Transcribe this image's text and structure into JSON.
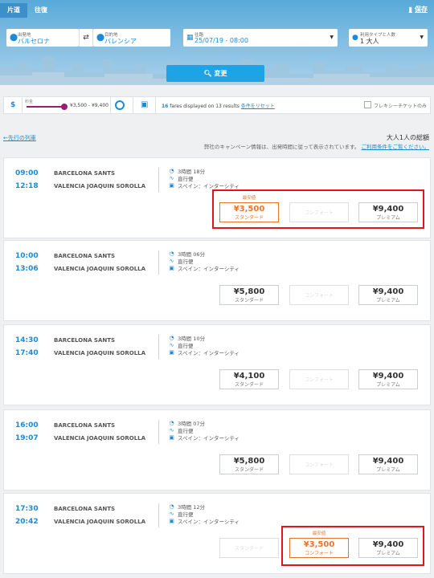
{
  "header": {
    "tabs": [
      {
        "label": "片道"
      },
      {
        "label": "往復"
      }
    ],
    "save_label": "保存"
  },
  "search": {
    "origin": {
      "label": "出発地",
      "value": "バルセロナ"
    },
    "destination": {
      "label": "目的地",
      "value": "バレンシア"
    },
    "date": {
      "label": "往路",
      "value": "25/07/19 - 08:00"
    },
    "passengers": {
      "label": "利用タイプと人数",
      "value": "1 大人"
    },
    "change_button": "変更"
  },
  "filters": {
    "currency_symbol": "$",
    "price_label": "料金",
    "price_range": "¥3,500 - ¥9,400",
    "results_count": "16",
    "results_text": "fares displayed on 13 results",
    "reset_link": "条件をリセット",
    "flexi_label": "フレキシーチケットのみ"
  },
  "list": {
    "prev_link": "先行の列車",
    "total_label": "大人1人の総額",
    "note_text": "弊社のキャンペーン情報は、出発時間に従って表示されています。",
    "note_link": "ご利用条件をご覧ください。",
    "cheapest_label": "最安値",
    "journeys": [
      {
        "dep_time": "09:00",
        "arr_time": "12:18",
        "dep_station": "BARCELONA SANTS",
        "arr_station": "VALENCIA JOAQUIN SOROLLA",
        "duration": "3時間 18分",
        "type": "直行便",
        "operator": "スペイン：インターシティ",
        "fares": [
          {
            "price": "¥3,500",
            "class": "スタンダード",
            "state": "cheapest"
          },
          {
            "price": "",
            "class": "コンフォート",
            "state": "disabled"
          },
          {
            "price": "¥9,400",
            "class": "プレミアム",
            "state": "normal"
          }
        ]
      },
      {
        "dep_time": "10:00",
        "arr_time": "13:06",
        "dep_station": "BARCELONA SANTS",
        "arr_station": "VALENCIA JOAQUIN SOROLLA",
        "duration": "3時間 06分",
        "type": "直行便",
        "operator": "スペイン：インターシティ",
        "fares": [
          {
            "price": "¥5,800",
            "class": "スタンダード",
            "state": "normal"
          },
          {
            "price": "",
            "class": "コンフォート",
            "state": "disabled"
          },
          {
            "price": "¥9,400",
            "class": "プレミアム",
            "state": "normal"
          }
        ]
      },
      {
        "dep_time": "14:30",
        "arr_time": "17:40",
        "dep_station": "BARCELONA SANTS",
        "arr_station": "VALENCIA JOAQUIN SOROLLA",
        "duration": "3時間 10分",
        "type": "直行便",
        "operator": "スペイン：インターシティ",
        "fares": [
          {
            "price": "¥4,100",
            "class": "スタンダード",
            "state": "normal"
          },
          {
            "price": "",
            "class": "コンフォート",
            "state": "disabled"
          },
          {
            "price": "¥9,400",
            "class": "プレミアム",
            "state": "normal"
          }
        ]
      },
      {
        "dep_time": "16:00",
        "arr_time": "19:07",
        "dep_station": "BARCELONA SANTS",
        "arr_station": "VALENCIA JOAQUIN SOROLLA",
        "duration": "3時間 07分",
        "type": "直行便",
        "operator": "スペイン：インターシティ",
        "fares": [
          {
            "price": "¥5,800",
            "class": "スタンダード",
            "state": "normal"
          },
          {
            "price": "",
            "class": "コンフォート",
            "state": "disabled"
          },
          {
            "price": "¥9,400",
            "class": "プレミアム",
            "state": "normal"
          }
        ]
      },
      {
        "dep_time": "17:30",
        "arr_time": "20:42",
        "dep_station": "BARCELONA SANTS",
        "arr_station": "VALENCIA JOAQUIN SOROLLA",
        "duration": "3時間 12分",
        "type": "直行便",
        "operator": "スペイン：インターシティ",
        "fares": [
          {
            "price": "",
            "class": "スタンダード",
            "state": "disabled"
          },
          {
            "price": "¥3,500",
            "class": "コンフォート",
            "state": "cheapest"
          },
          {
            "price": "¥9,400",
            "class": "プレミアム",
            "state": "normal"
          }
        ]
      }
    ]
  },
  "colors": {
    "accent": "#1c8ad6",
    "cheapest": "#e8742f",
    "highlight": "#e0161b",
    "slider": "#9b1d73"
  }
}
